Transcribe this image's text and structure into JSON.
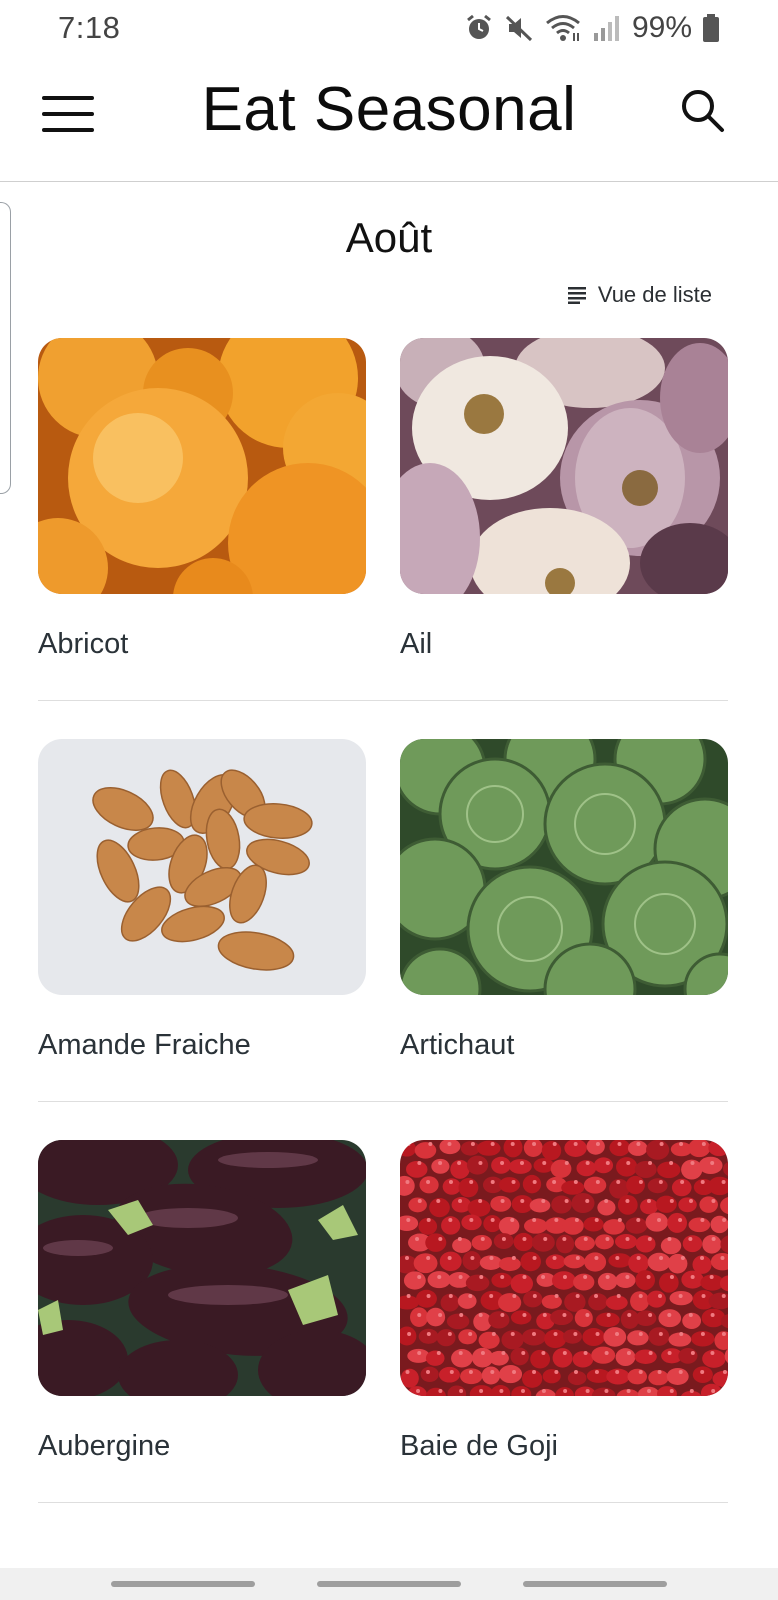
{
  "status_bar": {
    "time": "7:18",
    "battery": "99%",
    "icons": [
      "alarm-icon",
      "mute-icon",
      "wifi-icon",
      "signal-icon",
      "battery-icon"
    ]
  },
  "app_bar": {
    "title": "Eat Seasonal",
    "menu_icon": "hamburger-menu-icon",
    "search_icon": "search-icon"
  },
  "page": {
    "month": "Août",
    "view_toggle_label": "Vue de liste",
    "view_toggle_icon": "list-view-icon"
  },
  "items": [
    {
      "label": "Abricot"
    },
    {
      "label": "Ail"
    },
    {
      "label": "Amande Fraiche"
    },
    {
      "label": "Artichaut"
    },
    {
      "label": "Aubergine"
    },
    {
      "label": "Baie de Goji"
    }
  ],
  "colors": {
    "title": "#0c0c0c",
    "label": "#2a3238",
    "divider": "#dedede"
  }
}
